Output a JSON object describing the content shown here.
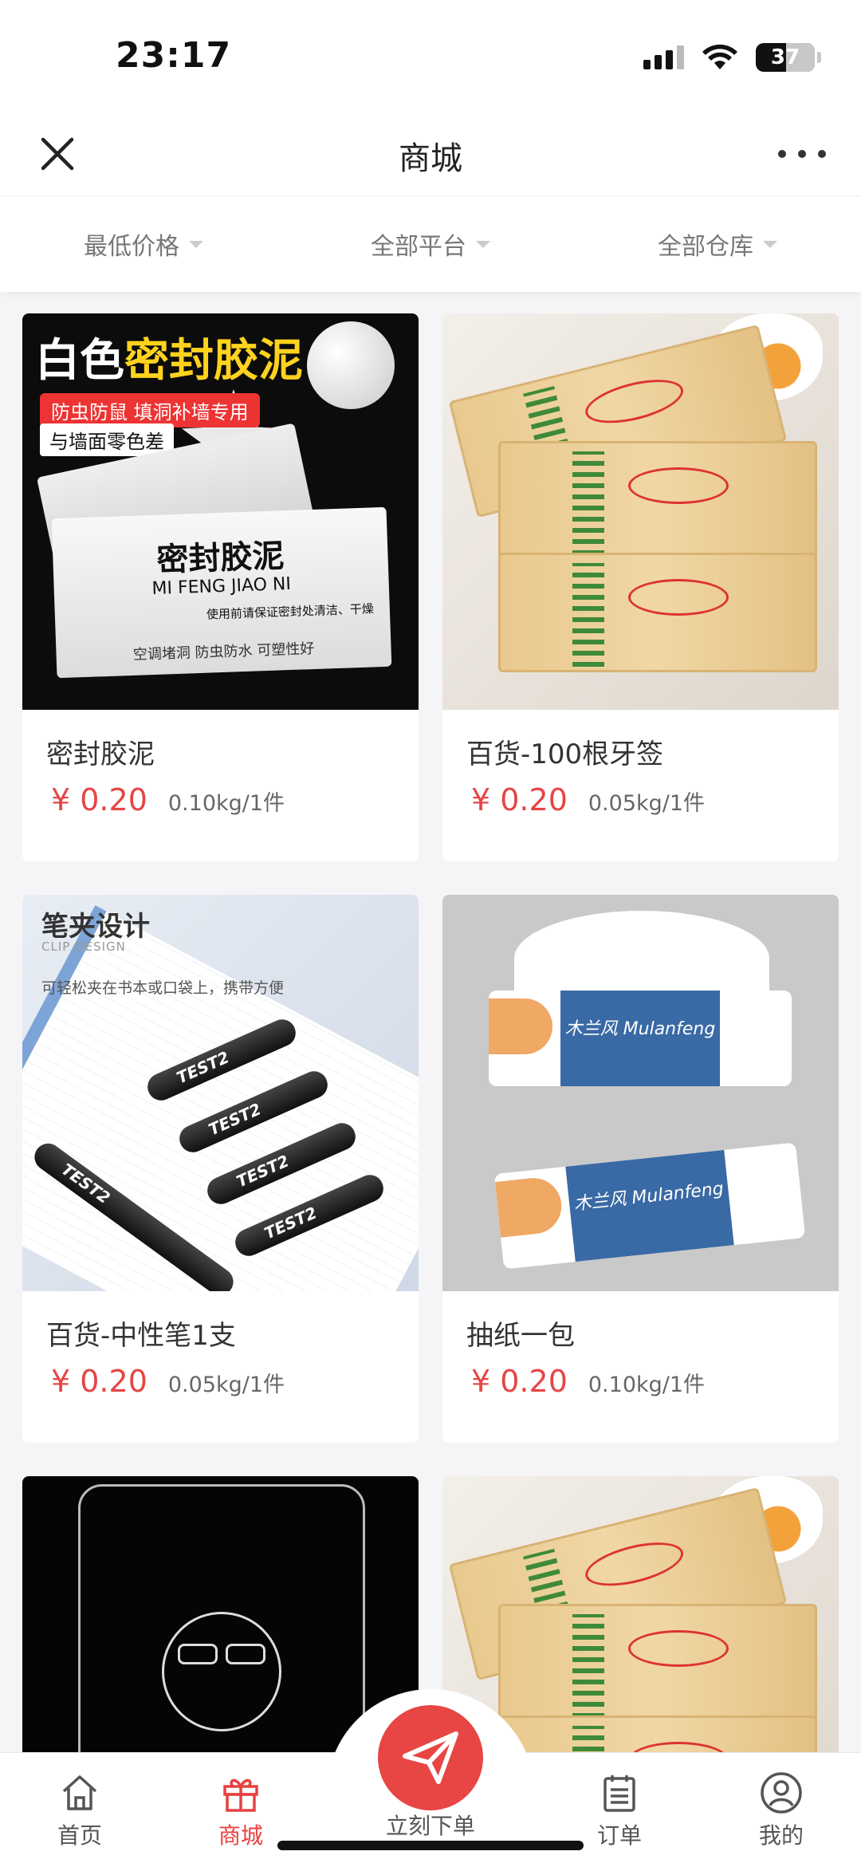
{
  "status": {
    "time": "23:17",
    "battery": "37"
  },
  "nav": {
    "title": "商城"
  },
  "filters": [
    {
      "label": "最低价格"
    },
    {
      "label": "全部平台"
    },
    {
      "label": "全部仓库"
    }
  ],
  "products": [
    {
      "name": "密封胶泥",
      "price": "¥ 0.20",
      "weight": "0.10kg/1件",
      "image": {
        "headline_white": "白色",
        "headline_yellow": "密封胶泥",
        "tag_red": "防虫防鼠 填洞补墙专用",
        "tag_white": "与墙面零色差",
        "pack_title": "密封胶泥",
        "pack_sub": "MI FENG JIAO NI",
        "pack_note": "使用前请保证密封处清洁、干燥",
        "pack_foot": "空调堵洞  防虫防水  可塑性好"
      }
    },
    {
      "name": "百货-100根牙签",
      "price": "¥ 0.20",
      "weight": "0.05kg/1件"
    },
    {
      "name": "百货-中性笔1支",
      "price": "¥ 0.20",
      "weight": "0.05kg/1件",
      "image": {
        "heading": "笔夹设计",
        "sub": "CLIP DESIGN",
        "desc": "可轻松夹在书本或口袋上，携带方便",
        "pen_text": "TEST2"
      }
    },
    {
      "name": "抽纸一包",
      "price": "¥ 0.20",
      "weight": "0.10kg/1件",
      "image": {
        "brand": "木兰风 Mulanfeng"
      }
    }
  ],
  "tabbar": {
    "home": "首页",
    "mall": "商城",
    "order_now": "立刻下单",
    "orders": "订单",
    "mine": "我的"
  },
  "colors": {
    "accent": "#e84545",
    "price": "#e64545"
  }
}
